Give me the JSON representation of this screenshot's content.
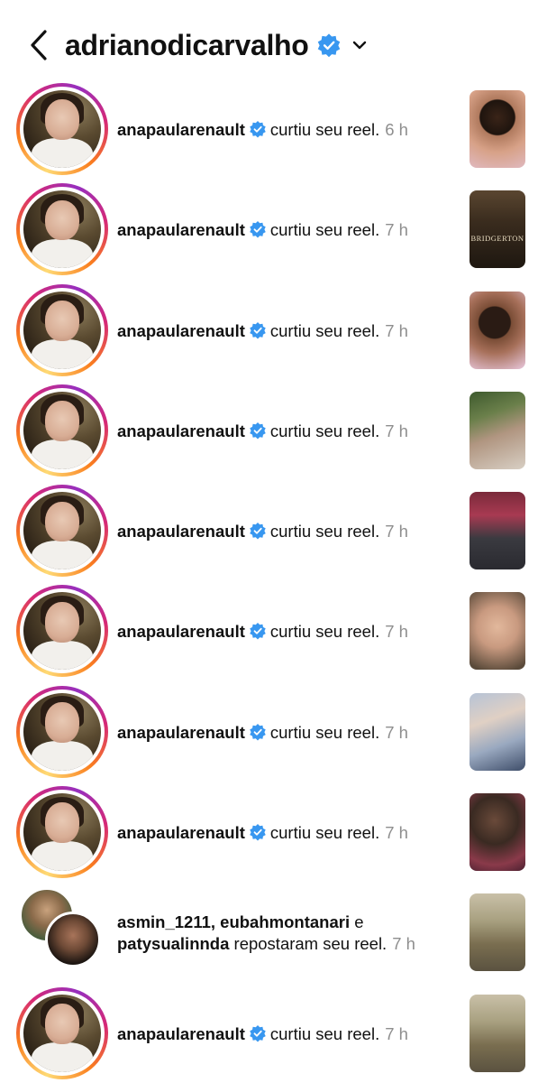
{
  "header": {
    "title": "adrianodicarvalho",
    "verified_icon": "verified-badge-icon",
    "back_icon": "chevron-left-icon",
    "dropdown_icon": "chevron-down-icon"
  },
  "colors": {
    "verified_blue": "#3897f0",
    "time_gray": "#8e8e8e"
  },
  "rows": [
    {
      "type": "like",
      "username": "anapaularenault",
      "action": "curtiu seu reel.",
      "time": "6 h"
    },
    {
      "type": "like",
      "username": "anapaularenault",
      "action": "curtiu seu reel.",
      "time": "7 h"
    },
    {
      "type": "like",
      "username": "anapaularenault",
      "action": "curtiu seu reel.",
      "time": "7 h"
    },
    {
      "type": "like",
      "username": "anapaularenault",
      "action": "curtiu seu reel.",
      "time": "7 h"
    },
    {
      "type": "like",
      "username": "anapaularenault",
      "action": "curtiu seu reel.",
      "time": "7 h"
    },
    {
      "type": "like",
      "username": "anapaularenault",
      "action": "curtiu seu reel.",
      "time": "7 h"
    },
    {
      "type": "like",
      "username": "anapaularenault",
      "action": "curtiu seu reel.",
      "time": "7 h"
    },
    {
      "type": "like",
      "username": "anapaularenault",
      "action": "curtiu seu reel.",
      "time": "7 h"
    },
    {
      "type": "repost",
      "users_line1": "asmin_1211, eubahmontanari",
      "conj": "e",
      "user3": "patysualinnda",
      "action": "repostaram seu reel.",
      "time": "7 h"
    },
    {
      "type": "like",
      "username": "anapaularenault",
      "action": "curtiu seu reel.",
      "time": "7 h"
    }
  ],
  "thumbnails": [
    {
      "label": ""
    },
    {
      "label": "BRIDGERTON"
    },
    {
      "label": ""
    },
    {
      "label": ""
    },
    {
      "label": ""
    },
    {
      "label": ""
    },
    {
      "label": ""
    },
    {
      "label": ""
    },
    {
      "label": ""
    },
    {
      "label": ""
    }
  ]
}
